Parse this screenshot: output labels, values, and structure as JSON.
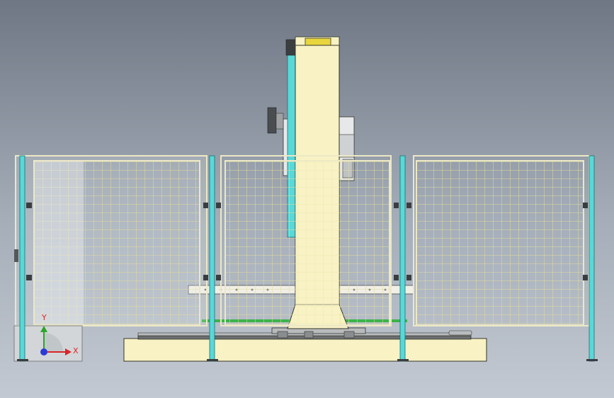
{
  "view": {
    "background_top": "#6f7784",
    "background_bottom": "#c3c9d2"
  },
  "colors": {
    "machine_body": "#f8f2c4",
    "outline": "#33352a",
    "fence_frame": "#ece8c6",
    "fence_mesh": "#e8e2a8",
    "post": "#59d8d8",
    "accent_yellow": "#e9d63e",
    "track_green": "#3bb34a",
    "panel_grey": "#d3d6d8"
  },
  "triad": {
    "x_label": "X",
    "y_label": "Y",
    "x_color": "#d8262a",
    "y_color": "#2aa62a",
    "z_color": "#2a3bd8"
  }
}
